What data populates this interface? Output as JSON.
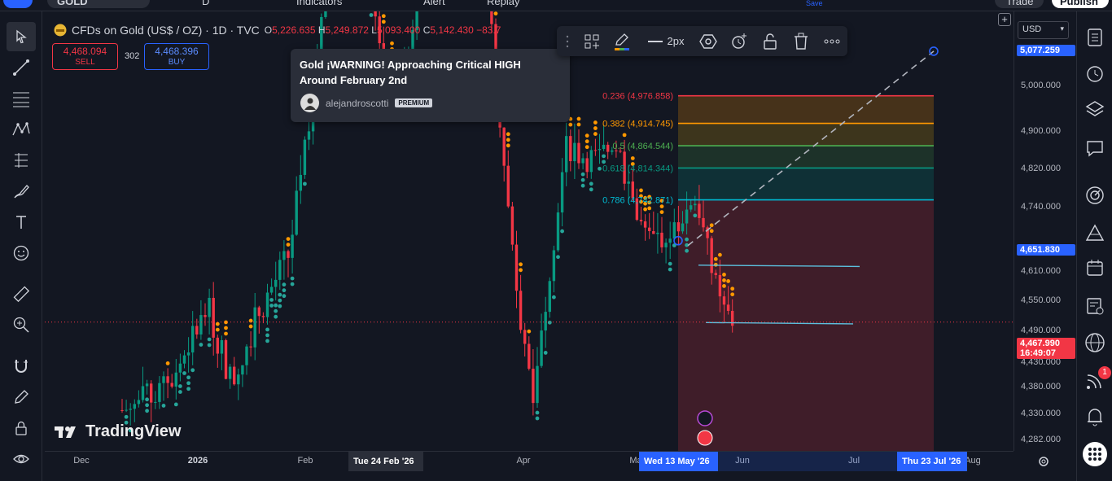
{
  "topbar": {
    "symbol": "GOLD",
    "interval": "D",
    "indicators_label": "Indicators",
    "alert_label": "Alert",
    "replay_label": "Replay",
    "save_label": "Save",
    "trade_label": "Trade",
    "publish_label": "Publish"
  },
  "symbol_info": {
    "name": "CFDs on Gold (US$ / OZ) · 1D · TVC",
    "open_label": "O",
    "open": "5,226.635",
    "high_label": "H",
    "high": "5,249.872",
    "low_label": "L",
    "low": "5,093.400",
    "close_label": "C",
    "close": "5,142.430",
    "change": "−83.7"
  },
  "trade": {
    "sell_price": "4,468.094",
    "sell_label": "SELL",
    "spread": "302",
    "buy_price": "4,468.396",
    "buy_label": "BUY"
  },
  "idea_card": {
    "title": "Gold ¡WARNING! Approaching Critical HIGH Around February 2nd",
    "author": "alejandroscotti",
    "badge": "PREMIUM"
  },
  "draw_toolbar": {
    "stroke_width": "2px"
  },
  "currency": "USD",
  "price_axis": {
    "labels": [
      "5,000.000",
      "4,900.000",
      "4,820.000",
      "4,740.000",
      "4,610.000",
      "4,550.000",
      "4,490.000",
      "4,430.000",
      "4,380.000",
      "4,330.000",
      "4,282.000"
    ],
    "tag_top": {
      "value": "5,077.259",
      "color": "#2962ff"
    },
    "tag_line": {
      "value": "4,651.830",
      "color": "#2962ff"
    },
    "tag_current": {
      "value": "4,467.990",
      "countdown": "16:49:07",
      "color": "#f23645"
    }
  },
  "time_axis": {
    "labels": [
      "Dec",
      "2026",
      "Feb",
      "Apr",
      "Ma",
      "Jun",
      "Jul",
      "Aug"
    ],
    "cursor_date": "Tue 24 Feb '26",
    "range_start": "Wed 13 May '26",
    "range_end": "Thu 23 Jul '26"
  },
  "fib_levels": [
    {
      "label": "0.236 (4,976.858)",
      "ratio": 0.236,
      "price": 4976.858,
      "color": "#f23645"
    },
    {
      "label": "0.382 (4,914.745)",
      "ratio": 0.382,
      "price": 4914.745,
      "color": "#ff9800"
    },
    {
      "label": "0.5 (4,864.544)",
      "ratio": 0.5,
      "price": 4864.544,
      "color": "#4caf50"
    },
    {
      "label": "0.618 (4,814.344)",
      "ratio": 0.618,
      "price": 4814.344,
      "color": "#089981"
    },
    {
      "label": "0.786 (4,742.871)",
      "ratio": 0.786,
      "price": 4742.871,
      "color": "#00bcd4"
    }
  ],
  "watermark": "TradingView",
  "right_toolbar": {
    "notification_count": "1"
  }
}
